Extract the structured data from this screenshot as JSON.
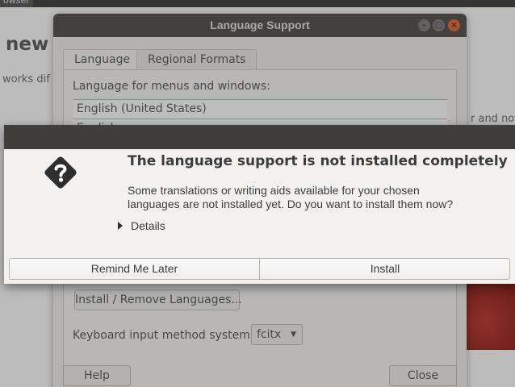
{
  "background": {
    "browser_tab_label": "owser",
    "headline": "new",
    "line_text": "works dif",
    "right_text": "r and noti"
  },
  "language_support_window": {
    "title": "Language Support",
    "tabs": [
      {
        "label": "Language",
        "active": true
      },
      {
        "label": "Regional Formats",
        "active": false
      }
    ],
    "list_label": "Language for menus and windows:",
    "languages": [
      "English (United States)",
      "English"
    ],
    "install_remove_button": "Install / Remove Languages...",
    "keyboard_label": "Keyboard input method system:",
    "keyboard_value": "fcitx",
    "help_button": "Help",
    "close_button": "Close"
  },
  "dialog": {
    "heading": "The language support is not installed completely",
    "body_lines": [
      "Some translations or writing aids available for your chosen",
      "languages are not installed yet. Do you want to install them now?"
    ],
    "details_label": "Details",
    "remind_button": "Remind Me Later",
    "install_button": "Install",
    "icon": "question-mark-icon"
  },
  "colors": {
    "titlebar": "#3f3e3a",
    "close_button": "#e0603a",
    "accent_red": "#b8342a"
  }
}
